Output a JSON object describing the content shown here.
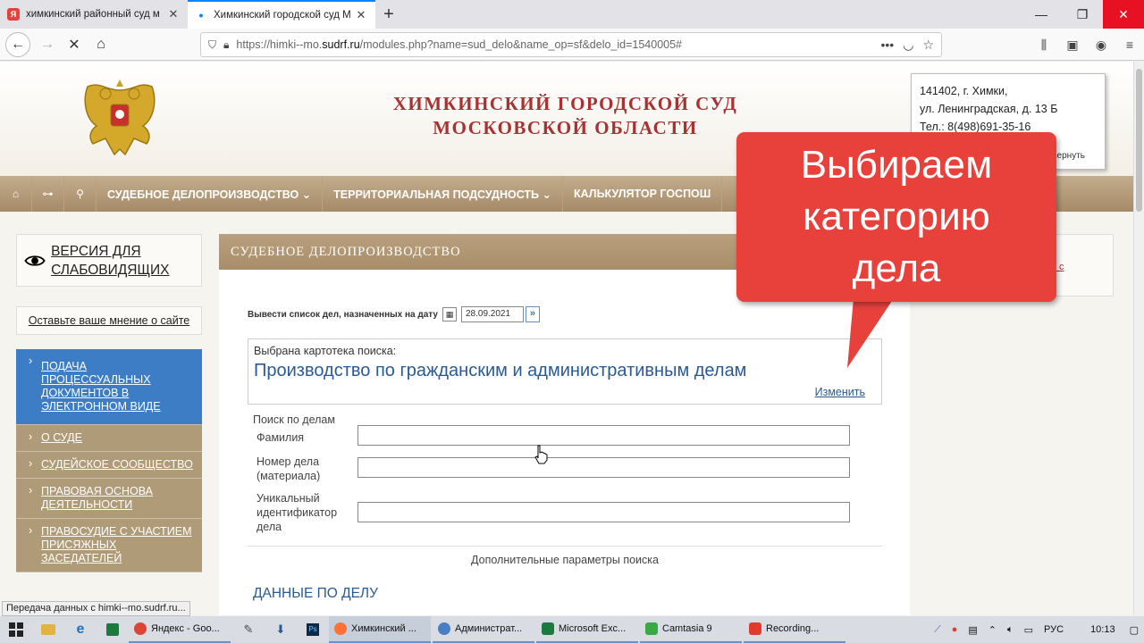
{
  "browser": {
    "tabs": [
      {
        "title": "химкинский районный суд м",
        "active": false,
        "favicon": "yandex-icon"
      },
      {
        "title": "Химкинский городской суд М",
        "active": true,
        "favicon": "loading-icon"
      }
    ],
    "url_prefix": "https://himki--mo.",
    "url_domain": "sudrf.ru",
    "url_path": "/modules.php?name=sud_delo&name_op=sf&delo_id=1540005#"
  },
  "header": {
    "title_line1": "ХИМКИНСКИЙ ГОРОДСКОЙ СУД",
    "title_line2": "МОСКОВСКОЙ ОБЛАСТИ",
    "address": [
      "141402, г. Химки,",
      "ул. Ленинградская, д. 13 Б",
      "Тел.: 8(498)691-35-16"
    ],
    "address_toggle": "вернуть"
  },
  "menu": {
    "items": [
      "СУДЕБНОЕ ДЕЛОПРОИЗВОДСТВО ⌄",
      "ТЕРРИТОРИАЛЬНАЯ ПОДСУДНОСТЬ ⌄",
      "КАЛЬКУЛЯТОР ГОСПОШ"
    ]
  },
  "sidebar": {
    "vision_label": "ВЕРСИЯ ДЛЯ СЛАБОВИДЯЩИХ",
    "opinion_label": "Оставьте ваше мнение о сайте",
    "items": [
      "ПОДАЧА ПРОЦЕССУАЛЬНЫХ ДОКУМЕНТОВ В ЭЛЕКТРОННОМ ВИДЕ",
      "О СУДЕ",
      "СУДЕЙСКОЕ СООБЩЕСТВО",
      "ПРАВОВАЯ ОСНОВА ДЕЯТЕЛЬНОСТИ",
      "ПРАВОСУДИЕ С УЧАСТИЕМ ПРИСЯЖНЫХ ЗАСЕДАТЕЛЕЙ"
    ]
  },
  "main": {
    "heading": "СУДЕБНОЕ ДЕЛОПРОИЗВОДСТВО",
    "date_label": "Вывести список дел, назначенных на дату",
    "date_value": "28.09.2021",
    "selected_label": "Выбрана картотека поиска:",
    "selected_value": "Производство по гражданским и административным делам",
    "change_link": "Изменить",
    "search_title": "Поиск по делам",
    "fields": [
      "Фамилия",
      "Номер дела (материала)",
      "Уникальный идентификатор дела"
    ],
    "extra_params": "Дополнительные параметры поиска",
    "case_data": "ДАННЫЕ ПО ДЕЛУ"
  },
  "right_box_text": "от с",
  "callout": {
    "lines": [
      "Выбираем",
      "категорию",
      "дела"
    ]
  },
  "status_text": "Передача данных с himki--mo.sudrf.ru...",
  "taskbar": {
    "apps": [
      "Яндекс - Goo...",
      "Химкинский ...",
      "Администрат...",
      "Microsoft Exc...",
      "Camtasia 9",
      "Recording..."
    ],
    "lang": "РУС",
    "time": "10:13"
  },
  "colors": {
    "court_red": "#a83232",
    "menu_brown": "#a68a68",
    "link_blue": "#2a5a94",
    "callout_red": "#e8413c",
    "sidebar_blue": "#3d7dc5"
  }
}
